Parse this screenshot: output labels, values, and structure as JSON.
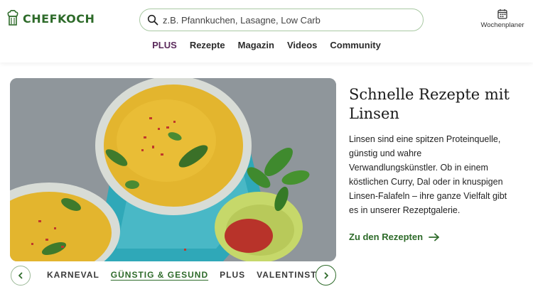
{
  "header": {
    "logo_text": "CHEFKOCH",
    "search": {
      "placeholder": "z.B. Pfannkuchen, Lasagne, Low Carb",
      "value": ""
    },
    "planner_label": "Wochenplaner"
  },
  "nav": {
    "items": [
      {
        "label": "PLUS"
      },
      {
        "label": "Rezepte"
      },
      {
        "label": "Magazin"
      },
      {
        "label": "Videos"
      },
      {
        "label": "Community"
      }
    ]
  },
  "hero": {
    "headline": "Schnelle Rezepte mit Linsen",
    "description": "Linsen sind eine spitzen Proteinquelle, günstig und wahre Verwandlungskünstler. Ob in einem köstlichen Curry, Dal oder in knuspigen Linsen-Falafeln – ihre ganze Vielfalt gibt es in unserer Rezeptgalerie.",
    "cta_label": "Zu den Rezepten"
  },
  "categories": {
    "items": [
      {
        "label": "KARNEVAL",
        "active": false
      },
      {
        "label": "GÜNSTIG & GESUND",
        "active": true
      },
      {
        "label": "PLUS",
        "active": false
      },
      {
        "label": "VALENTINSTAG",
        "active": false
      }
    ]
  },
  "colors": {
    "brand_green": "#2e6b2a",
    "plus_purple": "#5b2b5c",
    "search_border": "#a9c9a3"
  }
}
